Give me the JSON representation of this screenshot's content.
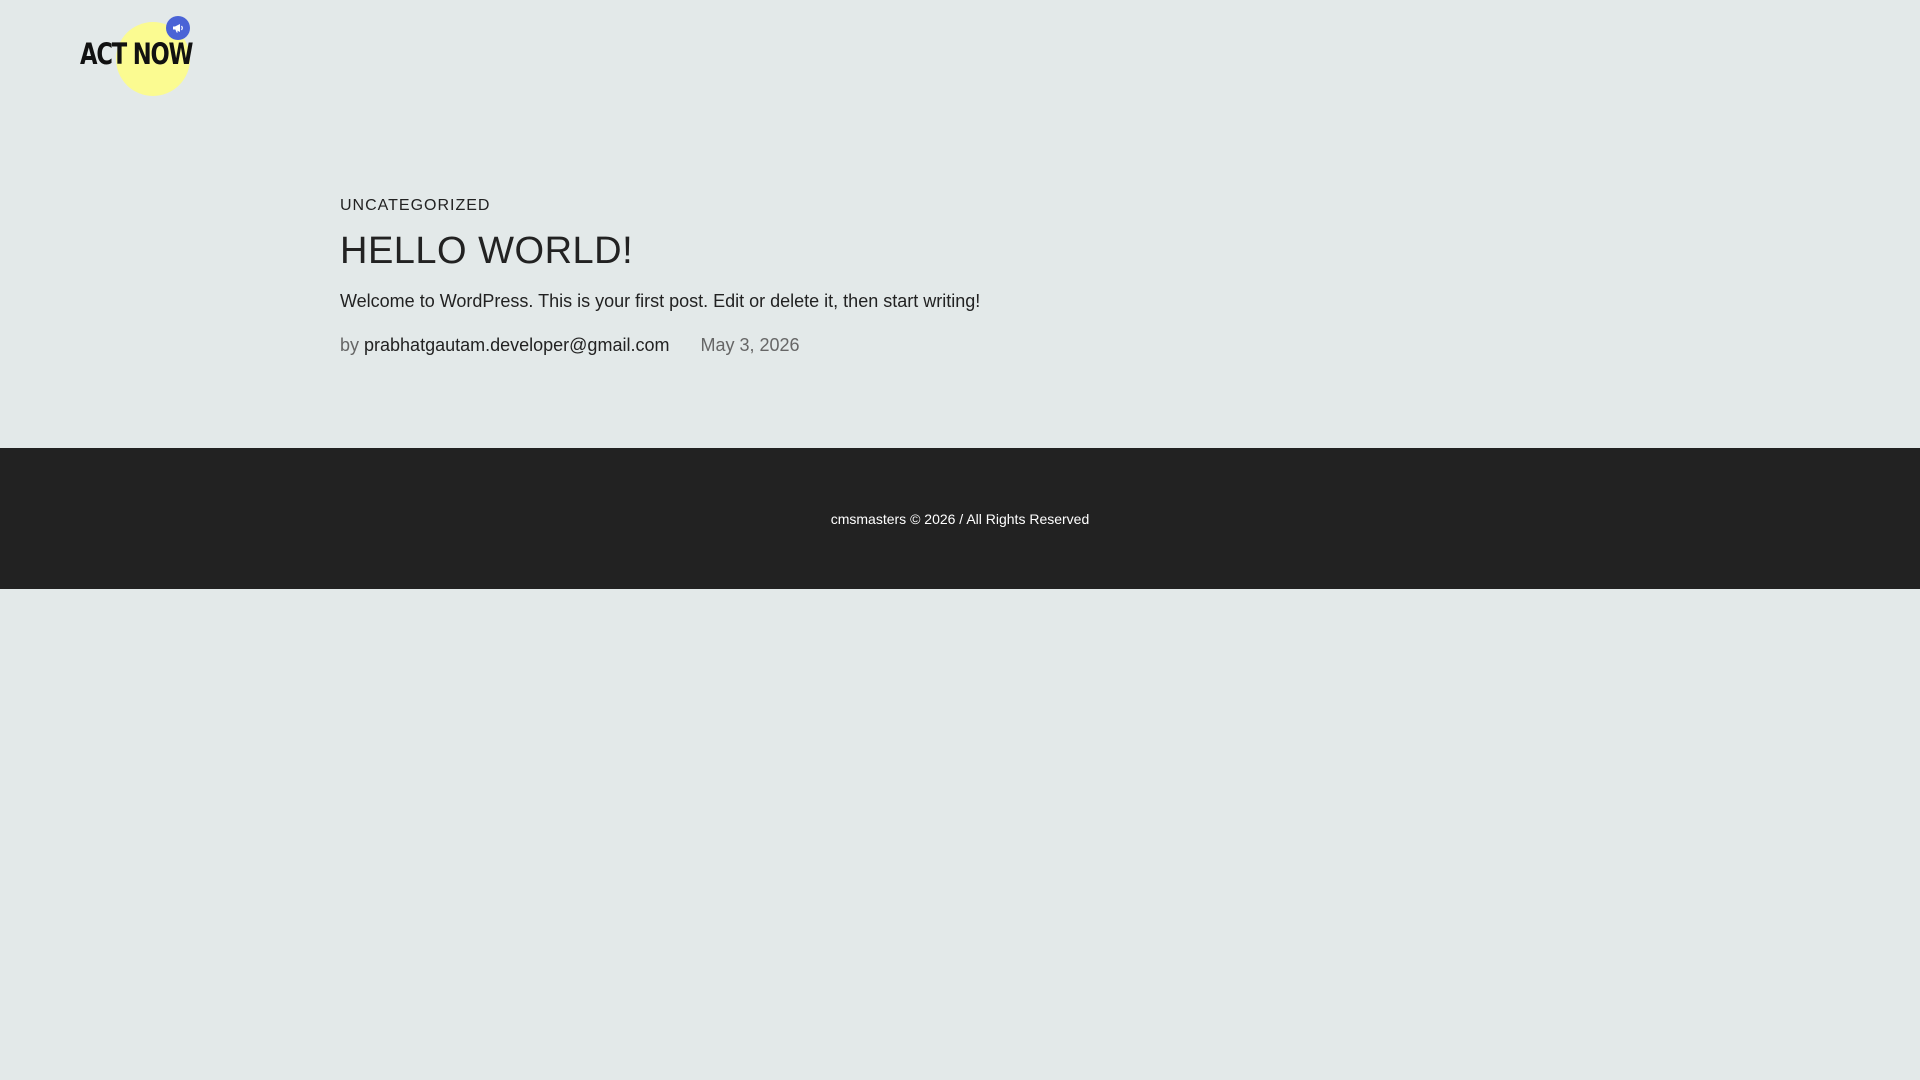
{
  "colors": {
    "background": "#e3e9e9",
    "text": "#222222",
    "muted_text": "#666666",
    "footer_background": "#222222",
    "footer_text": "#ffffff",
    "logo_circle": "#fbfb91",
    "logo_badge": "#4a63d6"
  },
  "header": {
    "logo": {
      "text": "ACT NOW",
      "badge_icon": "megaphone-icon"
    }
  },
  "post": {
    "category": "UNCATEGORIZED",
    "title": "HELLO WORLD!",
    "excerpt": "Welcome to WordPress. This is your first post. Edit or delete it, then start writing!",
    "meta": {
      "by_label": "by",
      "author": "prabhatgautam.developer@gmail.com",
      "date": "May 3, 2026"
    }
  },
  "footer": {
    "copyright": "cmsmasters © 2026 / All Rights Reserved"
  }
}
